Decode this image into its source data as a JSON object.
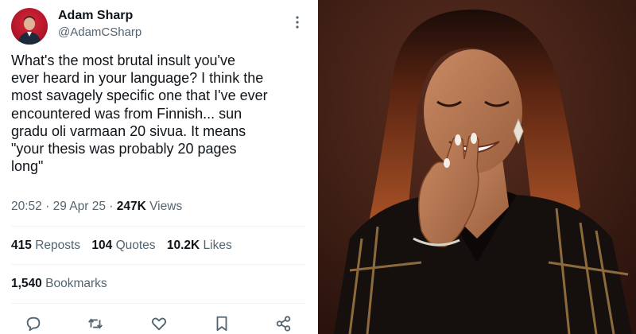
{
  "tweet": {
    "author": {
      "name": "Adam Sharp",
      "handle": "@AdamCSharp"
    },
    "text_lines": [
      "What's the most brutal insult you've",
      "ever heard in your language? I think the",
      "most savagely specific one that I've ever",
      "encountered was from Finnish... sun",
      "gradu oli varmaan 20 sivua. It means",
      "\"your thesis was probably 20 pages",
      "long\""
    ],
    "meta": {
      "time": "20:52",
      "separator": "·",
      "date": "29 Apr 25",
      "views_count": "247K",
      "views_label": "Views"
    },
    "stats": {
      "reposts_count": "415",
      "reposts_label": "Reposts",
      "quotes_count": "104",
      "quotes_label": "Quotes",
      "likes_count": "10.2K",
      "likes_label": "Likes"
    },
    "bookmarks": {
      "count": "1,540",
      "label": "Bookmarks"
    },
    "actions": [
      "reply-icon",
      "repost-icon",
      "like-icon",
      "bookmark-icon",
      "share-icon"
    ]
  },
  "photo": {
    "subject": "woman laughing covering mouth with hand",
    "background_color": "#3d1e14"
  },
  "colors": {
    "text_primary": "#0f1419",
    "text_secondary": "#536471",
    "divider": "#eff3f4",
    "avatar_red": "#c41e30"
  }
}
